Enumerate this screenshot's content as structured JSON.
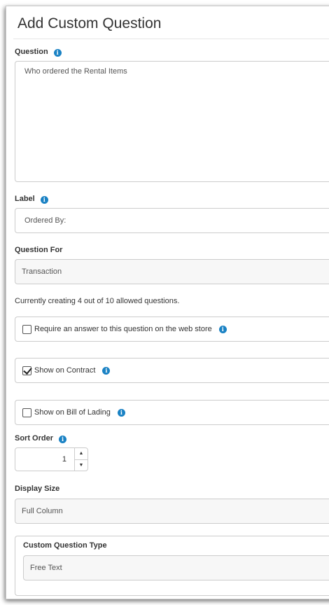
{
  "dialog": {
    "title": "Add Custom Question"
  },
  "question": {
    "label": "Question",
    "value": "Who ordered the Rental Items"
  },
  "label_field": {
    "label": "Label",
    "placeholder": "Ordered By:"
  },
  "question_for": {
    "label": "Question For",
    "selected": "Transaction"
  },
  "quota_text": "Currently creating 4 out of 10 allowed questions.",
  "checkboxes": {
    "require_answer": {
      "label": "Require an answer to this question on the web store",
      "checked": false
    },
    "show_on_contract": {
      "label": "Show on Contract",
      "checked": true
    },
    "show_on_bill_of_lading": {
      "label": "Show on Bill of Lading",
      "checked": false
    }
  },
  "sort_order": {
    "label": "Sort Order",
    "value": "1"
  },
  "display_size": {
    "label": "Display Size",
    "selected": "Full Column"
  },
  "custom_question_type": {
    "label": "Custom Question Type",
    "selected": "Free Text"
  },
  "icons": {
    "info": "info-icon",
    "stepper_up": "chevron-up-icon",
    "stepper_down": "chevron-down-icon"
  },
  "colors": {
    "info_icon": "#1a82c4",
    "border": "#cccccc",
    "text": "#333333"
  }
}
